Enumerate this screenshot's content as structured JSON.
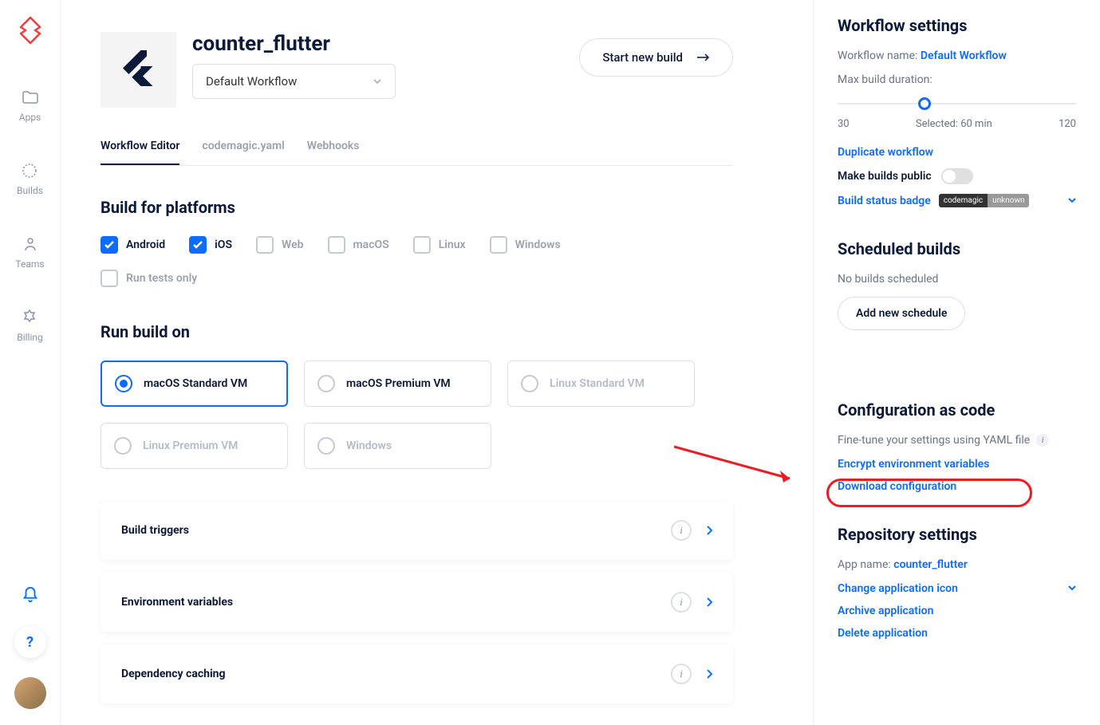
{
  "sidebar": {
    "nav": [
      {
        "label": "Apps"
      },
      {
        "label": "Builds"
      },
      {
        "label": "Teams"
      },
      {
        "label": "Billing"
      }
    ]
  },
  "header": {
    "title": "counter_flutter",
    "workflow_select": "Default Workflow",
    "start_button": "Start new build"
  },
  "tabs": [
    {
      "label": "Workflow Editor",
      "active": true
    },
    {
      "label": "codemagic.yaml",
      "active": false
    },
    {
      "label": "Webhooks",
      "active": false
    }
  ],
  "platforms": {
    "title": "Build for platforms",
    "items": [
      {
        "label": "Android",
        "checked": true
      },
      {
        "label": "iOS",
        "checked": true
      },
      {
        "label": "Web",
        "checked": false
      },
      {
        "label": "macOS",
        "checked": false
      },
      {
        "label": "Linux",
        "checked": false
      },
      {
        "label": "Windows",
        "checked": false
      }
    ],
    "run_tests": {
      "label": "Run tests only",
      "checked": false
    }
  },
  "run_on": {
    "title": "Run build on",
    "vms": [
      {
        "label": "macOS Standard VM",
        "selected": true,
        "disabled": false
      },
      {
        "label": "macOS Premium VM",
        "selected": false,
        "disabled": false
      },
      {
        "label": "Linux Standard VM",
        "selected": false,
        "disabled": true
      },
      {
        "label": "Linux Premium VM",
        "selected": false,
        "disabled": true
      },
      {
        "label": "Windows",
        "selected": false,
        "disabled": true
      }
    ]
  },
  "sections": [
    {
      "title": "Build triggers"
    },
    {
      "title": "Environment variables"
    },
    {
      "title": "Dependency caching"
    }
  ],
  "settings": {
    "title": "Workflow settings",
    "name_label": "Workflow name:",
    "name_value": "Default Workflow",
    "duration_label": "Max build duration:",
    "slider": {
      "min": "30",
      "selected": "Selected: 60 min",
      "max": "120"
    },
    "duplicate": "Duplicate workflow",
    "public_label": "Make builds public",
    "badge_label": "Build status badge",
    "badge_left": "codemagic",
    "badge_right": "unknown"
  },
  "scheduled": {
    "title": "Scheduled builds",
    "empty": "No builds scheduled",
    "button": "Add new schedule"
  },
  "config_code": {
    "title": "Configuration as code",
    "desc": "Fine-tune your settings using YAML file",
    "encrypt": "Encrypt environment variables",
    "download": "Download configuration"
  },
  "repo": {
    "title": "Repository settings",
    "name_label": "App name:",
    "name_value": "counter_flutter",
    "change_icon": "Change application icon",
    "archive": "Archive application",
    "delete": "Delete application"
  }
}
